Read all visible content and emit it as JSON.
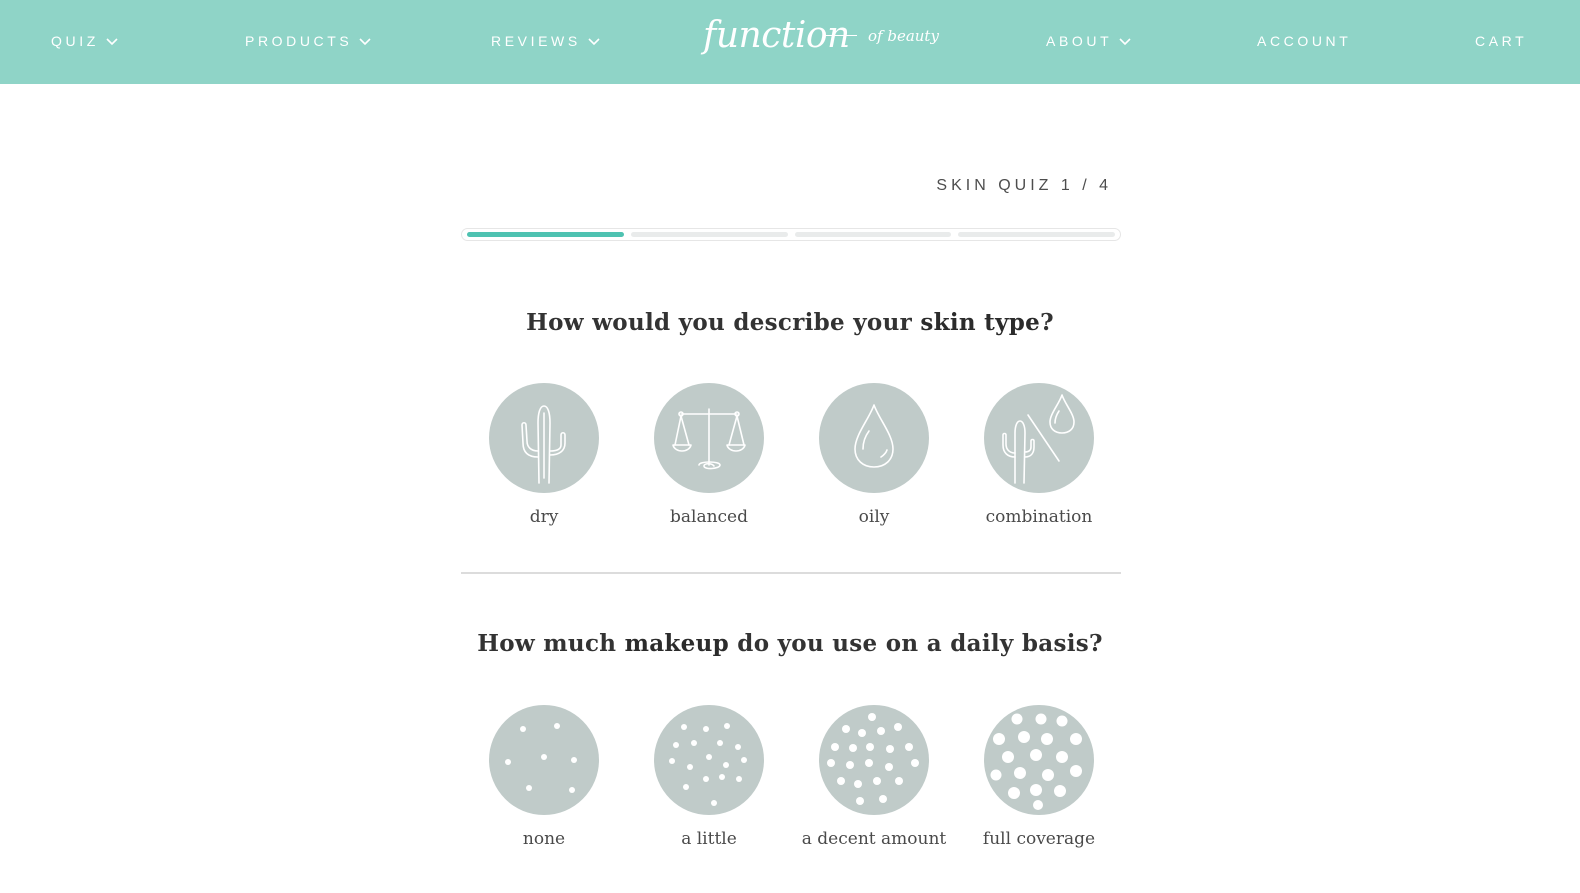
{
  "nav": {
    "quiz": "QUIZ",
    "products": "PRODUCTS",
    "reviews": "REVIEWS",
    "about": "ABOUT",
    "account": "ACCOUNT",
    "cart": "CART"
  },
  "logo": {
    "main": "function",
    "sub": "of beauty"
  },
  "quiz": {
    "step_label": "SKIN QUIZ 1 / 4",
    "current_step": 1,
    "total_steps": 4
  },
  "questions": [
    {
      "prefix": "How would you describe your ",
      "bold": "skin type",
      "suffix": "?",
      "options": [
        {
          "label": "dry",
          "icon": "cactus-icon"
        },
        {
          "label": "balanced",
          "icon": "scales-icon"
        },
        {
          "label": "oily",
          "icon": "droplet-icon"
        },
        {
          "label": "combination",
          "icon": "cactus-droplet-icon"
        }
      ]
    },
    {
      "prefix": "How much ",
      "bold": "makeup",
      "suffix": " do you use on a daily basis?",
      "options": [
        {
          "label": "none",
          "icon": "sparse-dots-icon"
        },
        {
          "label": "a little",
          "icon": "few-dots-icon"
        },
        {
          "label": "a decent amount",
          "icon": "many-dots-icon"
        },
        {
          "label": "full coverage",
          "icon": "dense-dots-icon"
        }
      ]
    }
  ],
  "colors": {
    "header_bg": "#8fd4c7",
    "progress_active": "#4ec2b1",
    "progress_inactive": "#e9ebeb",
    "option_circle": "#c0cbc9"
  }
}
